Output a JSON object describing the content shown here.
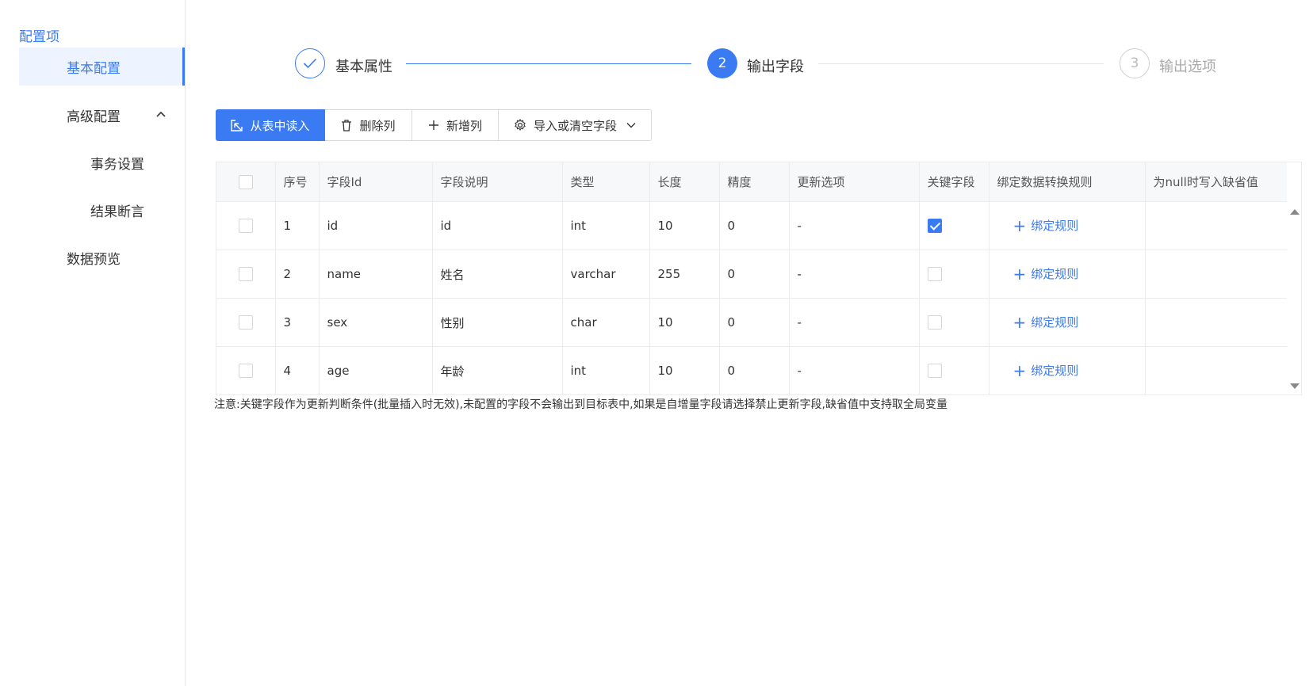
{
  "sidebar": {
    "title": "配置项",
    "items": [
      {
        "label": "基本配置"
      },
      {
        "label": "高级配置"
      },
      {
        "label": "事务设置"
      },
      {
        "label": "结果断言"
      },
      {
        "label": "数据预览"
      }
    ]
  },
  "steps": [
    {
      "index": "✓",
      "title": "基本属性",
      "status": "finished"
    },
    {
      "index": "2",
      "title": "输出字段",
      "status": "current"
    },
    {
      "index": "3",
      "title": "输出选项",
      "status": "pending"
    }
  ],
  "toolbar": {
    "read_from_table": "从表中读入",
    "delete_column": "删除列",
    "add_column": "新增列",
    "import_or_clear": "导入或清空字段"
  },
  "table": {
    "headers": [
      "序号",
      "字段Id",
      "字段说明",
      "类型",
      "长度",
      "精度",
      "更新选项",
      "关键字段",
      "绑定数据转换规则",
      "为null时写入缺省值"
    ],
    "bind_label": "绑定规则",
    "rows": [
      {
        "no": "1",
        "field_id": "id",
        "desc": "id",
        "type": "int",
        "length": "10",
        "precision": "0",
        "update": "-",
        "key": true,
        "default": ""
      },
      {
        "no": "2",
        "field_id": "name",
        "desc": "姓名",
        "type": "varchar",
        "length": "255",
        "precision": "0",
        "update": "-",
        "key": false,
        "default": ""
      },
      {
        "no": "3",
        "field_id": "sex",
        "desc": "性别",
        "type": "char",
        "length": "10",
        "precision": "0",
        "update": "-",
        "key": false,
        "default": ""
      },
      {
        "no": "4",
        "field_id": "age",
        "desc": "年龄",
        "type": "int",
        "length": "10",
        "precision": "0",
        "update": "-",
        "key": false,
        "default": ""
      }
    ]
  },
  "note": "注意:关键字段作为更新判断条件(批量插入时无效),未配置的字段不会输出到目标表中,如果是自增量字段请选择禁止更新字段,缺省值中支持取全局变量",
  "colors": {
    "accent": "#3a7af2",
    "border": "#ececec",
    "header_bg": "#f7f8fa"
  }
}
